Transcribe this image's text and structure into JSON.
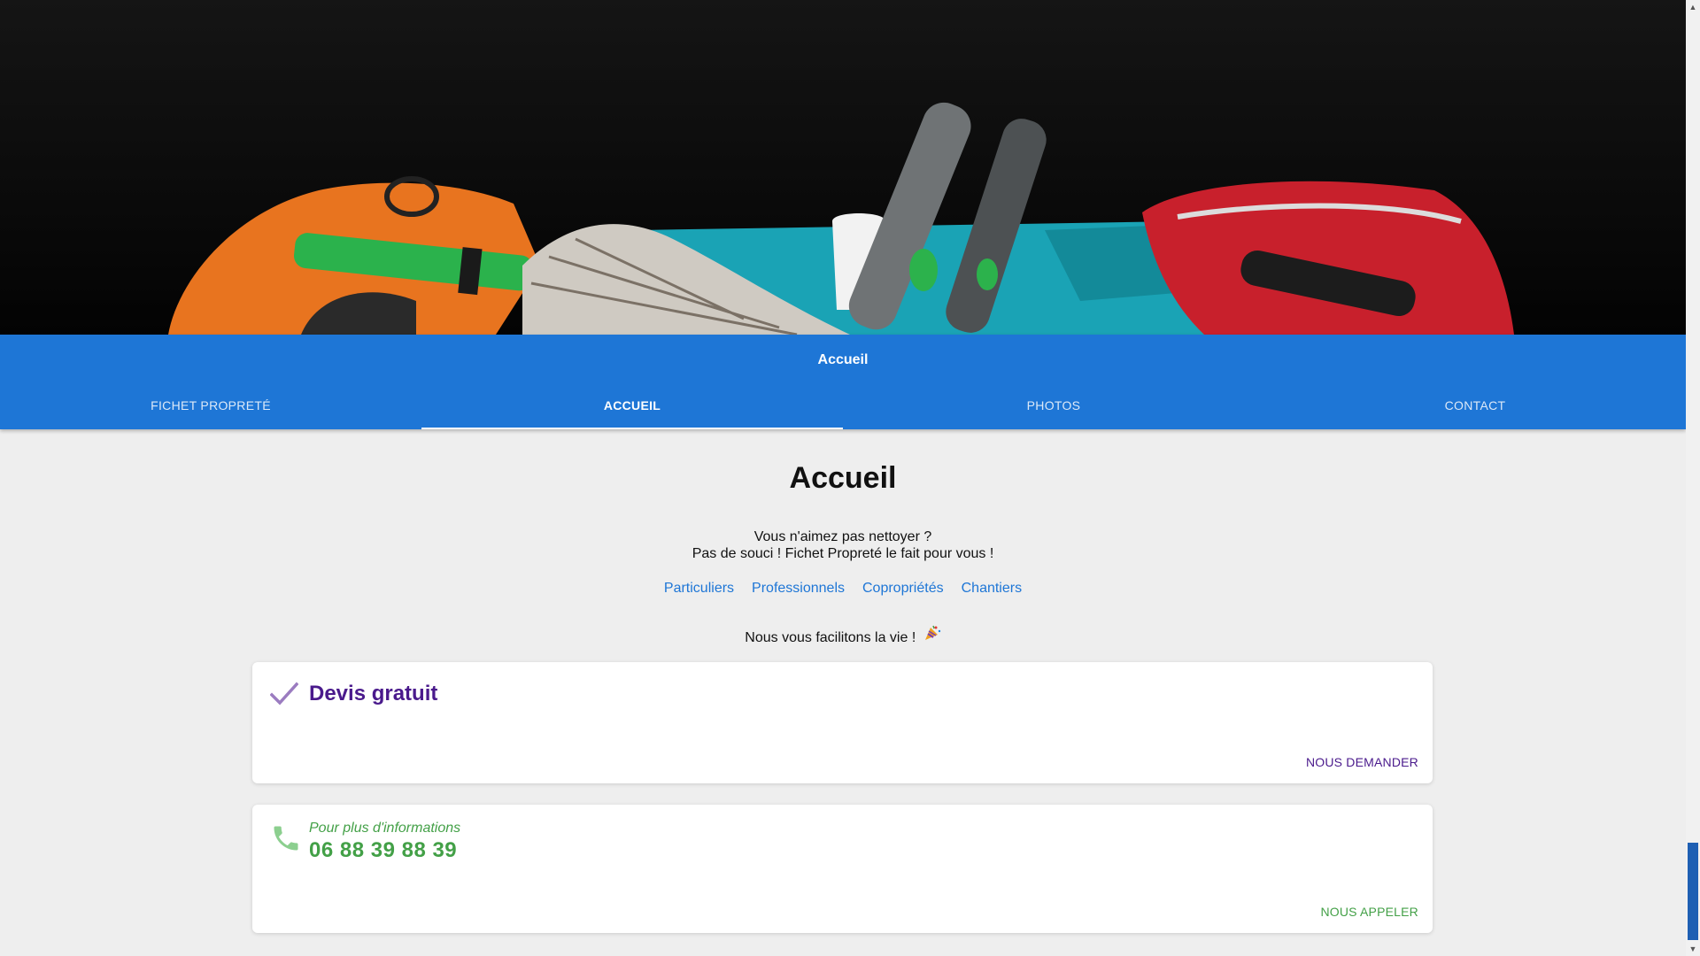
{
  "appbar": {
    "title": "Accueil"
  },
  "tabs": [
    {
      "label": "FICHET PROPRETÉ",
      "active": false
    },
    {
      "label": "ACCUEIL",
      "active": true
    },
    {
      "label": "PHOTOS",
      "active": false
    },
    {
      "label": "CONTACT",
      "active": false
    }
  ],
  "main": {
    "heading": "Accueil",
    "intro_line1": "Vous n'aimez pas nettoyer ?",
    "intro_line2": "Pas de souci ! Fichet Propreté le fait pour vous !",
    "links": [
      "Particuliers",
      "Professionnels",
      "Copropriétés",
      "Chantiers"
    ],
    "tagline": "Nous vous facilitons la vie !",
    "tagline_emoji": "party-popper-icon"
  },
  "quote_card": {
    "icon": "check-icon",
    "title": "Devis gratuit",
    "action": "NOUS DEMANDER"
  },
  "phone_card": {
    "icon": "phone-icon",
    "subtitle": "Pour plus d'informations",
    "phone": "06 88 39 88 39",
    "action": "NOUS APPELER"
  },
  "colors": {
    "primary": "#1e76d6",
    "purple": "#4a1a8c",
    "green": "#43a047",
    "background": "#eeeeee"
  }
}
